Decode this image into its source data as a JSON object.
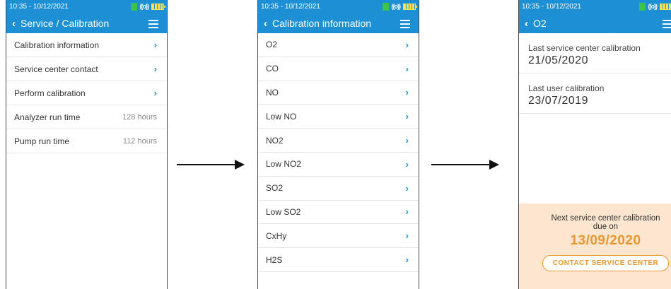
{
  "screen1": {
    "status_time": "10:35 - 10/12/2021",
    "title": "Service / Calibration",
    "items": [
      {
        "label": "Calibration information",
        "value": ""
      },
      {
        "label": "Service center contact",
        "value": ""
      },
      {
        "label": "Perform calibration",
        "value": ""
      },
      {
        "label": "Analyzer run time",
        "value": "128 hours"
      },
      {
        "label": "Pump run time",
        "value": "112 hours"
      }
    ]
  },
  "screen2": {
    "status_time": "10:35 - 10/12/2021",
    "title": "Calibration information",
    "items": [
      "O2",
      "CO",
      "NO",
      "Low NO",
      "NO2",
      "Low NO2",
      "SO2",
      "Low SO2",
      "CxHy",
      "H2S"
    ]
  },
  "screen3": {
    "status_time": "10:35 - 10/12/2021",
    "title": "O2",
    "last_service_label": "Last service center calibration",
    "last_service_date": "21/05/2020",
    "last_user_label": "Last user calibration",
    "last_user_date": "23/07/2019",
    "next_line1": "Next service center calibration",
    "next_line2": "due on",
    "next_date": "13/09/2020",
    "contact_button": "CONTACT SERVICE CENTER"
  },
  "icons": {
    "back": "‹",
    "chevron": "›",
    "wave": "((o))"
  },
  "colors": {
    "accent": "#1d8fd4",
    "orange": "#e8972f",
    "panel": "#fce6cf"
  }
}
